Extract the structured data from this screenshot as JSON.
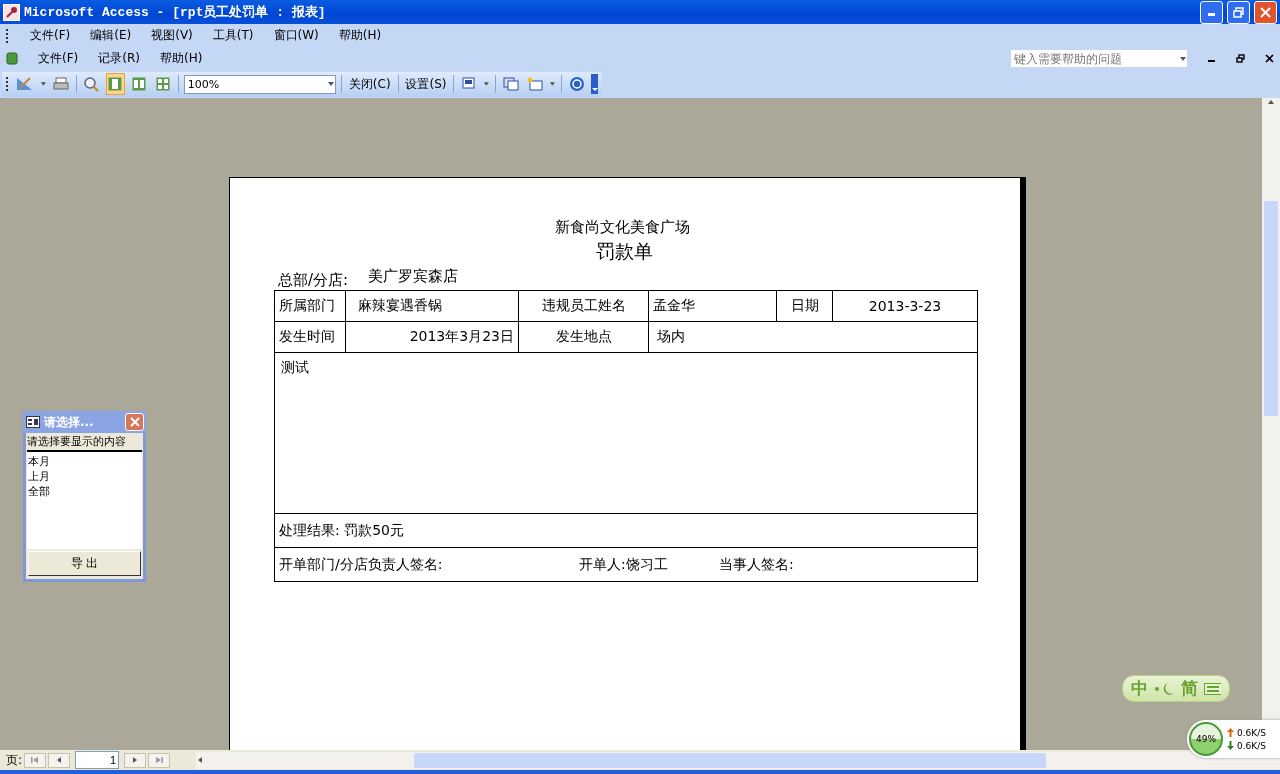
{
  "window": {
    "title": "Microsoft Access - [rpt员工处罚单 : 报表]"
  },
  "menu_bar": [
    "文件(F)",
    "编辑(E)",
    "视图(V)",
    "工具(T)",
    "窗口(W)",
    "帮助(H)"
  ],
  "menu_bar_2": [
    "文件(F)",
    "记录(R)",
    "帮助(H)"
  ],
  "help_box": {
    "placeholder": "键入需要帮助的问题"
  },
  "toolbar": {
    "view_buttons": [
      {
        "selected": true
      },
      {
        "selected": false
      },
      {
        "selected": false
      }
    ],
    "zoom": "100%",
    "buttons": [
      "关闭(C)",
      "设置(S)"
    ]
  },
  "report": {
    "company": "新食尚文化美食广场",
    "title": "罚款单",
    "branch_label": "总部/分店:",
    "branch_value": "美广罗宾森店",
    "row1": [
      "所属部门",
      "麻辣宴遇香锅",
      "违规员工姓名",
      "孟金华",
      "日期",
      "2013-3-23"
    ],
    "row2": [
      "发生时间",
      "2013年3月23日",
      "发生地点",
      "场内"
    ],
    "description": "测试",
    "result": "处理结果: 罚款50元",
    "signatures": [
      "开单部门/分店负责人签名:",
      "开单人:饶习工",
      "当事人签名:"
    ]
  },
  "dialog": {
    "title": "请选择...",
    "prompt": "请选择要显示的内容",
    "options": [
      {
        "label": "本月",
        "selected": false
      },
      {
        "label": "上月",
        "selected": false
      },
      {
        "label": "全部",
        "selected": false
      }
    ],
    "button": "导 出"
  },
  "navigation": {
    "label": "页:",
    "page": "1"
  },
  "ime_bar": [
    "中",
    "简"
  ],
  "network_widget": {
    "percent": "49%",
    "upload": "0.6K/S",
    "download": "0.6K/S"
  }
}
